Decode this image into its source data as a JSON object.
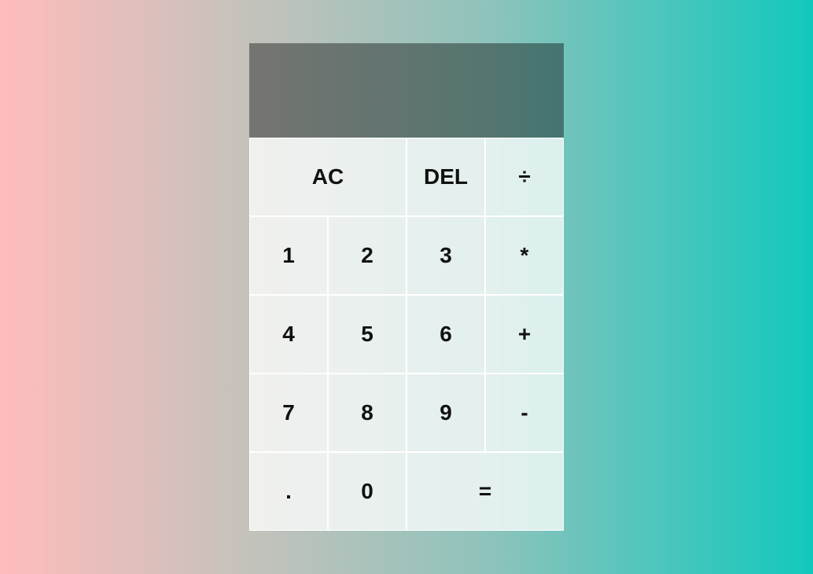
{
  "display": {
    "previous_operand": "",
    "current_operand": ""
  },
  "buttons": {
    "all_clear": "AC",
    "delete": "DEL",
    "divide": "÷",
    "one": "1",
    "two": "2",
    "three": "3",
    "multiply": "*",
    "four": "4",
    "five": "5",
    "six": "6",
    "plus": "+",
    "seven": "7",
    "eight": "8",
    "nine": "9",
    "minus": "-",
    "decimal": ".",
    "zero": "0",
    "equals": "="
  }
}
